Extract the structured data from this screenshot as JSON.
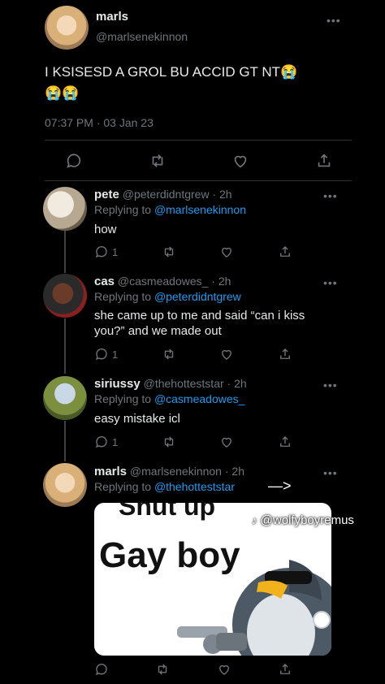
{
  "main_tweet": {
    "display_name": "marls",
    "handle": "@marlsenekinnon",
    "text": "I KSISESD  A GROL BU ACCID GT NT😭",
    "emoji_line": "😭😭",
    "timestamp": "07:37 PM · 03 Jan 23",
    "more": "•••"
  },
  "replies": [
    {
      "display_name": "pete",
      "handle": "@peterdidntgrew · 2h",
      "replying_prefix": "Replying to ",
      "replying_to": "@marlsenekinnon",
      "lines": [
        "how"
      ],
      "reply_count": "1",
      "more": "•••"
    },
    {
      "display_name": "cas",
      "handle": "@casmeadowes_ · 2h",
      "replying_prefix": "Replying to ",
      "replying_to": "@peterdidntgrew",
      "lines": [
        "she came up to me and said “can i kiss",
        "you?” and we made out"
      ],
      "reply_count": "1",
      "more": "•••"
    },
    {
      "display_name": "siriussy",
      "handle": "@thehotteststar · 2h",
      "replying_prefix": "Replying to ",
      "replying_to": "@casmeadowes_",
      "lines": [
        "easy mistake icl"
      ],
      "reply_count": "1",
      "more": "•••"
    },
    {
      "display_name": "marls",
      "handle": "@marlsenekinnon · 2h",
      "replying_prefix": "Replying to ",
      "replying_to": "@thehotteststar",
      "arrow": "—>",
      "more": "•••",
      "meme": {
        "top_text": "Shut up",
        "main_text": "Gay boy"
      }
    }
  ],
  "watermark": "@wolfyboyremus",
  "colors": {
    "background": "#000000",
    "text": "#e7e9ea",
    "muted": "#71767b",
    "link": "#1d9bf0",
    "divider": "#2f3336"
  }
}
